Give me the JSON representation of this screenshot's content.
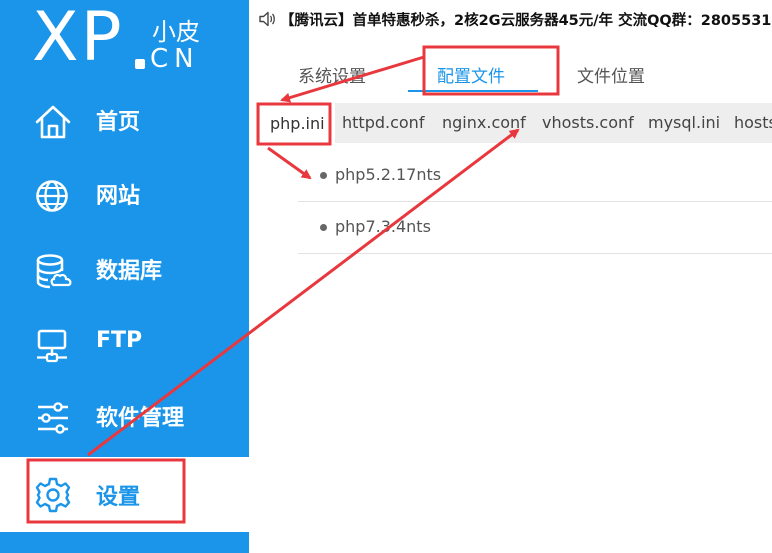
{
  "logo": {
    "main": "XP",
    "cn_top": "小皮",
    "cn_bottom": "CN"
  },
  "sidebar": {
    "items": [
      {
        "label": "首页",
        "icon": "home-icon"
      },
      {
        "label": "网站",
        "icon": "globe-icon"
      },
      {
        "label": "数据库",
        "icon": "database-icon"
      },
      {
        "label": "FTP",
        "icon": "ftp-icon"
      },
      {
        "label": "软件管理",
        "icon": "sliders-icon"
      },
      {
        "label": "设置",
        "icon": "gear-icon",
        "active": true
      }
    ]
  },
  "notice": {
    "icon": "speaker-icon",
    "text": "【腾讯云】首单特惠秒杀，2核2G云服务器45元/年 交流QQ群：2805531"
  },
  "tabs": [
    {
      "label": "系统设置"
    },
    {
      "label": "配置文件",
      "active": true
    },
    {
      "label": "文件位置"
    }
  ],
  "subtabs": [
    {
      "label": "php.ini",
      "active": true
    },
    {
      "label": "httpd.conf"
    },
    {
      "label": "nginx.conf"
    },
    {
      "label": "vhosts.conf"
    },
    {
      "label": "mysql.ini"
    },
    {
      "label": "hosts"
    }
  ],
  "versions": [
    {
      "label": "php5.2.17nts"
    },
    {
      "label": "php7.3.4nts"
    }
  ],
  "colors": {
    "accent": "#1a95ea",
    "annotation": "#e8383d"
  }
}
